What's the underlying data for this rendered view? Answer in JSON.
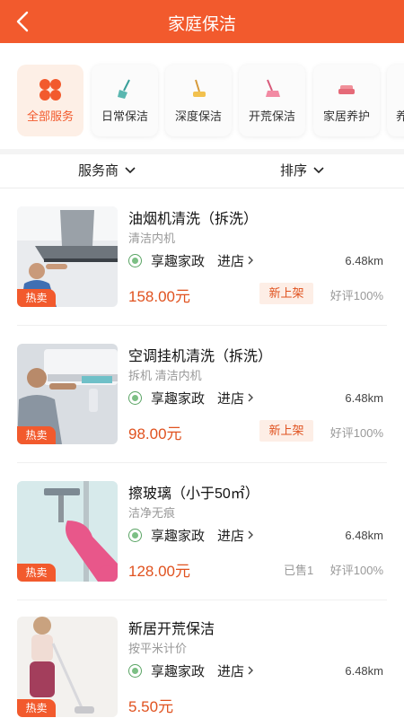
{
  "header": {
    "title": "家庭保洁"
  },
  "categories": [
    {
      "label": "全部服务",
      "icon": "grid-icon",
      "active": true
    },
    {
      "label": "日常保洁",
      "icon": "broom-icon",
      "active": false
    },
    {
      "label": "深度保洁",
      "icon": "mop-icon",
      "active": false
    },
    {
      "label": "开荒保洁",
      "icon": "brush-icon",
      "active": false
    },
    {
      "label": "家居养护",
      "icon": "sofa-icon",
      "active": false
    },
    {
      "label": "养",
      "icon": "partial-icon",
      "active": false
    }
  ],
  "filters": {
    "provider": "服务商",
    "sort": "排序"
  },
  "items": [
    {
      "title": "油烟机清洗（拆洗）",
      "tags": "清洁内机",
      "shop": "享趣家政",
      "enter": "进店",
      "distance": "6.48km",
      "price": "158.00元",
      "tag": "新上架",
      "sold": "",
      "rating": "好评100%",
      "badge": "热卖"
    },
    {
      "title": "空调挂机清洗（拆洗）",
      "tags": "拆机 清洁内机",
      "shop": "享趣家政",
      "enter": "进店",
      "distance": "6.48km",
      "price": "98.00元",
      "tag": "新上架",
      "sold": "",
      "rating": "好评100%",
      "badge": "热卖"
    },
    {
      "title": "擦玻璃（小于50㎡）",
      "tags": "洁净无痕",
      "shop": "享趣家政",
      "enter": "进店",
      "distance": "6.48km",
      "price": "128.00元",
      "tag": "",
      "sold": "已售1",
      "rating": "好评100%",
      "badge": "热卖"
    },
    {
      "title": "新居开荒保洁",
      "tags": "按平米计价",
      "shop": "享趣家政",
      "enter": "进店",
      "distance": "6.48km",
      "price": "5.50元",
      "tag": "",
      "sold": "",
      "rating": "",
      "badge": "热卖"
    }
  ],
  "colors": {
    "accent": "#f25a2d",
    "price": "#e0521f",
    "tag_bg": "#fdeee6"
  }
}
